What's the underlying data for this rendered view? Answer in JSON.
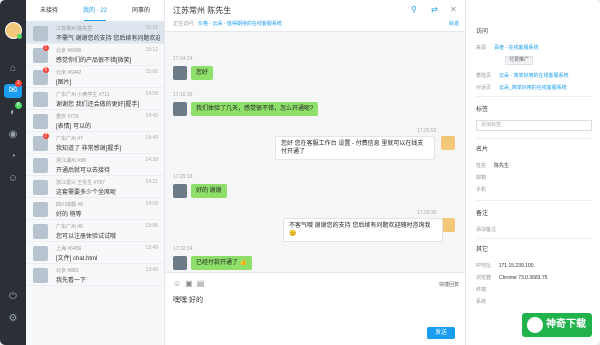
{
  "tabs": [
    {
      "label": "未接待"
    },
    {
      "label": "我的 · 22"
    },
    {
      "label": "同事的"
    }
  ],
  "conversations": [
    {
      "name": "江苏常州 陈先生",
      "time": "15:15",
      "msg": "不需气 谢谢您的支持 您后续有问题欢迎随"
    },
    {
      "name": "北京 #6996",
      "time": "15:12",
      "msg": "感觉你们的产品很不错[微笑]",
      "badge": "1"
    },
    {
      "name": "北京 #6942",
      "time": "15:06",
      "msg": "[图片]",
      "badge": "5"
    },
    {
      "name": "广东广州 小黄学生 #711",
      "time": "14:58",
      "msg": "谢谢您 我们还会做的更好[握手]"
    },
    {
      "name": "重庆 #729",
      "time": "14:45",
      "msg": "[表情] 可以的"
    },
    {
      "name": "广东广州 #7",
      "time": "14:40",
      "msg": "我知道了 非常感谢[握手]",
      "badge": "2"
    },
    {
      "name": "浙江湖州 #98",
      "time": "14:30",
      "msg": "开通后就可以去接待"
    },
    {
      "name": "浙江嘉兴 王先生 #787",
      "time": "14:21",
      "msg": "这套需要多少个坐席呢"
    },
    {
      "name": "四川成都 #8",
      "time": "14:09",
      "msg": "好的 稍等"
    },
    {
      "name": "广东广州 #6",
      "time": "13:58",
      "msg": "您可以注册体验试试哦"
    },
    {
      "name": "上海 #6456",
      "time": "13:49",
      "msg": "[文件] chat.html"
    },
    {
      "name": "北京 #883",
      "time": "13:40",
      "msg": "我先看一下"
    }
  ],
  "chat": {
    "title": "江苏常州 陈先生",
    "viewing_prefix": "正在访问：",
    "viewing_link": "价格 - 云朵 - 值得期待的在线客服系统",
    "trace": "轨迹",
    "messages": [
      {
        "time": "17:24:24",
        "text": "您好",
        "side": "in"
      },
      {
        "time": "17:16:36",
        "text": "我们体验了几天，感觉很不错，怎么开通呢?",
        "side": "in"
      },
      {
        "time": "17:26:52",
        "text": "您好 您在客服工作台 设置 - 付费信息 里就可以在线支付开通了",
        "side": "out"
      },
      {
        "time": "17:29:18",
        "text": "好的 谢谢",
        "side": "in"
      },
      {
        "time": "17:29:30",
        "text": "不客气哦 谢谢您的支持 您后续有问题欢迎随时咨询我 😊",
        "side": "out"
      },
      {
        "time": "17:32:34",
        "text": "已经付款开通了 👍",
        "side": "in"
      }
    ],
    "quick_reply": "快捷回复",
    "draft": "嘿嘿 好的",
    "send": "发送"
  },
  "info": {
    "visit_title": "访问",
    "visit_rows": [
      {
        "k": "来源",
        "v": "百度 - 在线客服系统",
        "link": true
      },
      {
        "k": "着陆页",
        "v": "云朵 - 简单好用的在线客服系统",
        "link": true
      },
      {
        "k": "对话页",
        "v": "云朵_简单好用的在线客服系统",
        "link": true
      }
    ],
    "chip": "付费推广",
    "tags_title": "标签",
    "tag_placeholder": "添加标签",
    "card_title": "名片",
    "card_rows": [
      {
        "k": "姓名",
        "v": "陈先生"
      },
      {
        "k": "邮箱",
        "v": ""
      },
      {
        "k": "手机",
        "v": ""
      }
    ],
    "note_title": "备注",
    "note_placeholder": "添加备注",
    "other_title": "其它",
    "other_rows": [
      {
        "k": "IP地址",
        "v": "171.15.239.100"
      },
      {
        "k": "浏览器",
        "v": "Chrome 73.0.3683.75"
      },
      {
        "k": "终端",
        "v": ""
      },
      {
        "k": "系统",
        "v": ""
      }
    ]
  },
  "watermark": "神奇下载"
}
